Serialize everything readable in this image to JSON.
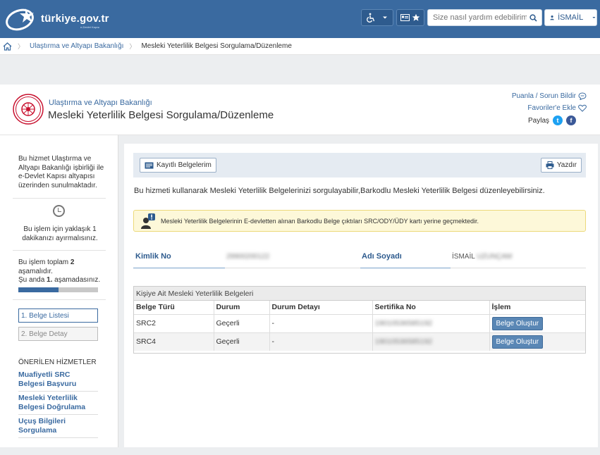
{
  "header": {
    "logo_text": "türkiye.gov.tr",
    "logo_subtext": "e-Devlet Kapısı",
    "search_placeholder": "Size nasıl yardım edebilirim?",
    "user_name": "İSMAİL"
  },
  "breadcrumb": {
    "items": [
      "Ulaştırma ve Altyapı Bakanlığı",
      "Mesleki Yeterlilik Belgesi Sorgulama/Düzenleme"
    ]
  },
  "page": {
    "ministry": "Ulaştırma ve Altyapı Bakanlığı",
    "title": "Mesleki Yeterlilik Belgesi Sorgulama/Düzenleme",
    "rate_link": "Puanla / Sorun Bildir",
    "favorite_link": "Favoriler'e Ekle",
    "share_label": "Paylaş"
  },
  "sidebar": {
    "provider_text": "Bu hizmet Ulaştırma ve Altyapı Bakanlığı işbirliği ile e-Devlet Kapısı altyapısı üzerinden sunulmaktadır.",
    "time_text": "Bu işlem için yaklaşık 1 dakikanızı ayırmalısınız.",
    "steps_total_prefix": "Bu işlem toplam ",
    "steps_total": "2",
    "steps_total_suffix": "aşamalıdır.",
    "current_step_prefix": "Şu anda ",
    "current_step": "1.",
    "current_step_suffix": " aşamadasınız.",
    "progress_fraction": 0.5,
    "steps": [
      "1. Belge Listesi",
      "2. Belge Detay"
    ],
    "recommended_title": "ÖNERİLEN HİZMETLER",
    "recommended": [
      "Muafiyetli SRC Belgesi Başvuru",
      "Mesleki Yeterlilik Belgesi Doğrulama",
      "Uçuş Bilgileri Sorgulama"
    ]
  },
  "main": {
    "my_records_button": "Kayıtlı Belgelerim",
    "print_button": "Yazdır",
    "intro": "Bu hizmeti kullanarak Mesleki Yeterlilik Belgelerinizi sorgulayabilir,Barkodlu Mesleki Yeterlilik Belgesi düzenleyebilirsiniz.",
    "alert": "Mesleki Yeterlilik Belgelerinin E-devletten alınan Barkodlu Belge çıktıları SRC/ODY/ÜDY kartı yerine geçmektedir.",
    "id_label": "Kimlik No",
    "id_value": "29900200122",
    "name_label": "Adı Soyadı",
    "name_value": "İSMAİL",
    "name_value_hidden": "UZUNÇAM",
    "table_caption": "Kişiye Ait Mesleki Yeterlilik Belgeleri",
    "table_headers": [
      "Belge Türü",
      "Durum",
      "Durum Detayı",
      "Sertifika No",
      "İşlem"
    ],
    "table_rows": [
      {
        "type": "SRC2",
        "status": "Geçerli",
        "detail": "-",
        "cert": "19010536585192",
        "action": "Belge Oluştur"
      },
      {
        "type": "SRC4",
        "status": "Geçerli",
        "detail": "-",
        "cert": "19010536585192",
        "action": "Belge Oluştur"
      }
    ]
  },
  "colors": {
    "brand": "#3a6aa0",
    "alert_bg": "#fdf8d9",
    "twitter": "#1da1f2",
    "facebook": "#3b5998"
  }
}
